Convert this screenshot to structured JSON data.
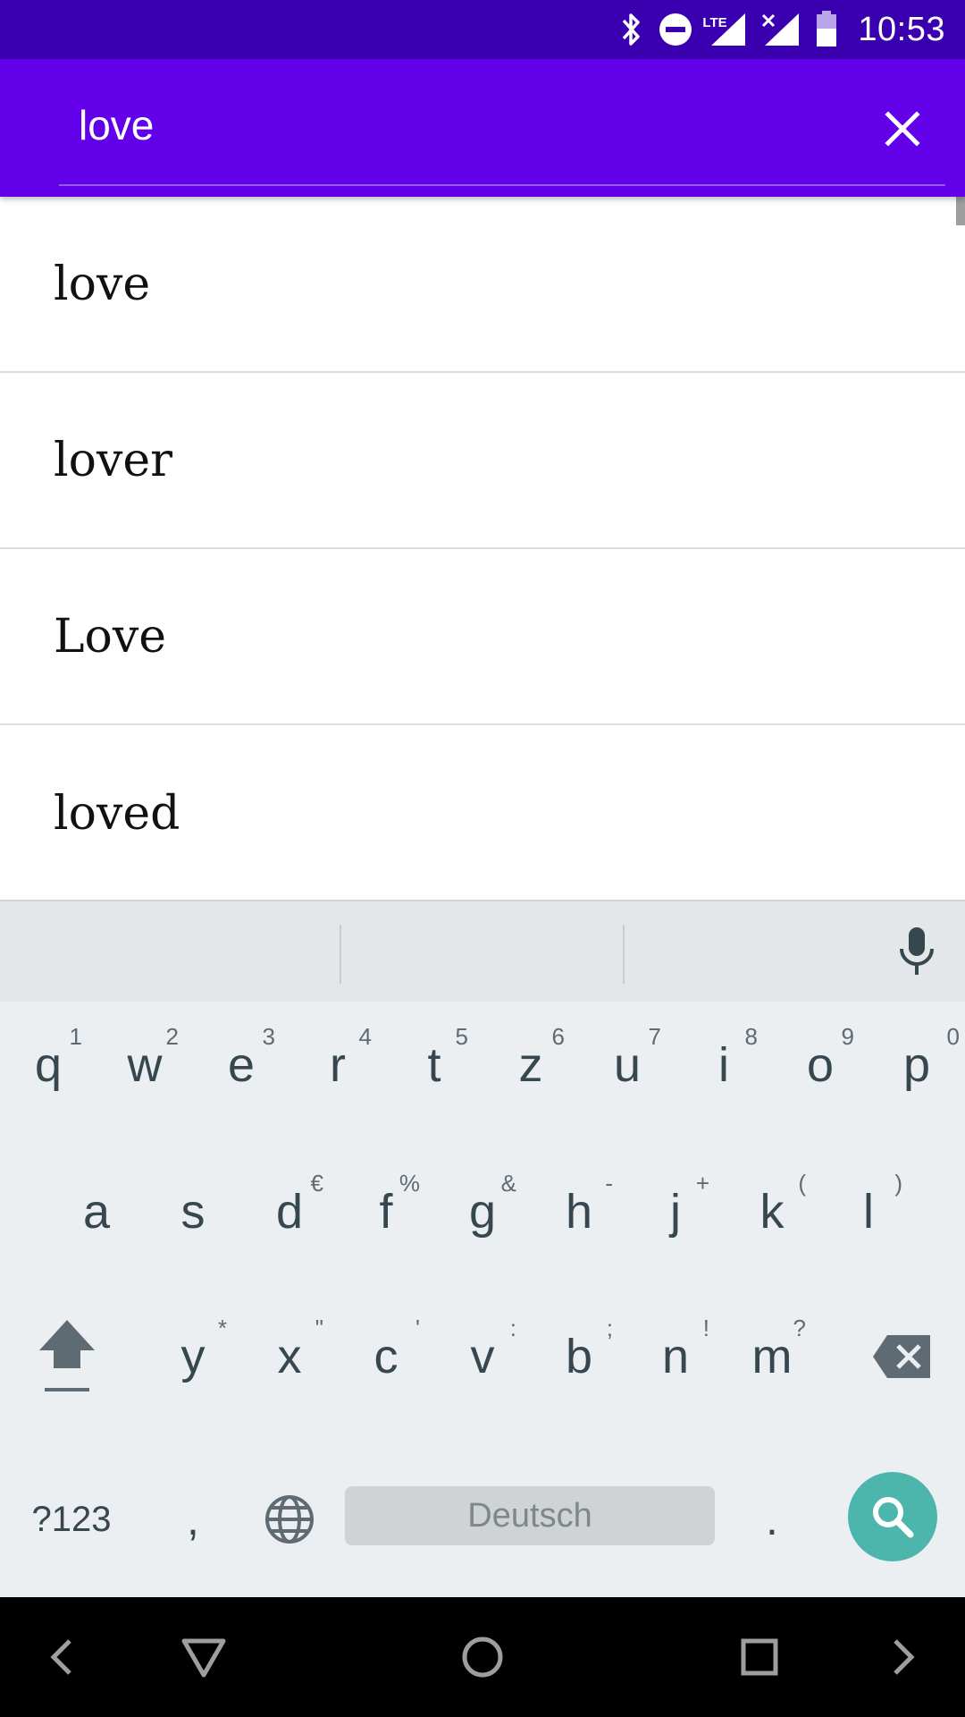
{
  "status_bar": {
    "time": "10:53",
    "network_label": "LTE",
    "icons": [
      "bluetooth-icon",
      "do-not-disturb-icon",
      "lte-signal-icon",
      "signal-no-data-icon",
      "battery-icon"
    ]
  },
  "search": {
    "query": "love",
    "clear_icon": "close-icon"
  },
  "results": [
    {
      "label": "love"
    },
    {
      "label": "lover"
    },
    {
      "label": "Love"
    },
    {
      "label": "loved"
    }
  ],
  "keyboard": {
    "row1": [
      {
        "key": "q",
        "hint": "1"
      },
      {
        "key": "w",
        "hint": "2"
      },
      {
        "key": "e",
        "hint": "3"
      },
      {
        "key": "r",
        "hint": "4"
      },
      {
        "key": "t",
        "hint": "5"
      },
      {
        "key": "z",
        "hint": "6"
      },
      {
        "key": "u",
        "hint": "7"
      },
      {
        "key": "i",
        "hint": "8"
      },
      {
        "key": "o",
        "hint": "9"
      },
      {
        "key": "p",
        "hint": "0"
      }
    ],
    "row2": [
      {
        "key": "a",
        "hint": ""
      },
      {
        "key": "s",
        "hint": ""
      },
      {
        "key": "d",
        "hint": "€"
      },
      {
        "key": "f",
        "hint": "%"
      },
      {
        "key": "g",
        "hint": "&"
      },
      {
        "key": "h",
        "hint": "-"
      },
      {
        "key": "j",
        "hint": "+"
      },
      {
        "key": "k",
        "hint": "("
      },
      {
        "key": "l",
        "hint": ")"
      }
    ],
    "row3": [
      {
        "key": "y",
        "hint": "*"
      },
      {
        "key": "x",
        "hint": "\""
      },
      {
        "key": "c",
        "hint": "'"
      },
      {
        "key": "v",
        "hint": ":"
      },
      {
        "key": "b",
        "hint": ";"
      },
      {
        "key": "n",
        "hint": "!"
      },
      {
        "key": "m",
        "hint": "?"
      }
    ],
    "symbols_label": "?123",
    "comma_label": ",",
    "period_label": ".",
    "space_label": "Deutsch"
  },
  "colors": {
    "status_bar": "#3a00b0",
    "app_bar": "#6200ea",
    "search_key": "#4db6ac",
    "keyboard_bg": "#eceff1"
  }
}
